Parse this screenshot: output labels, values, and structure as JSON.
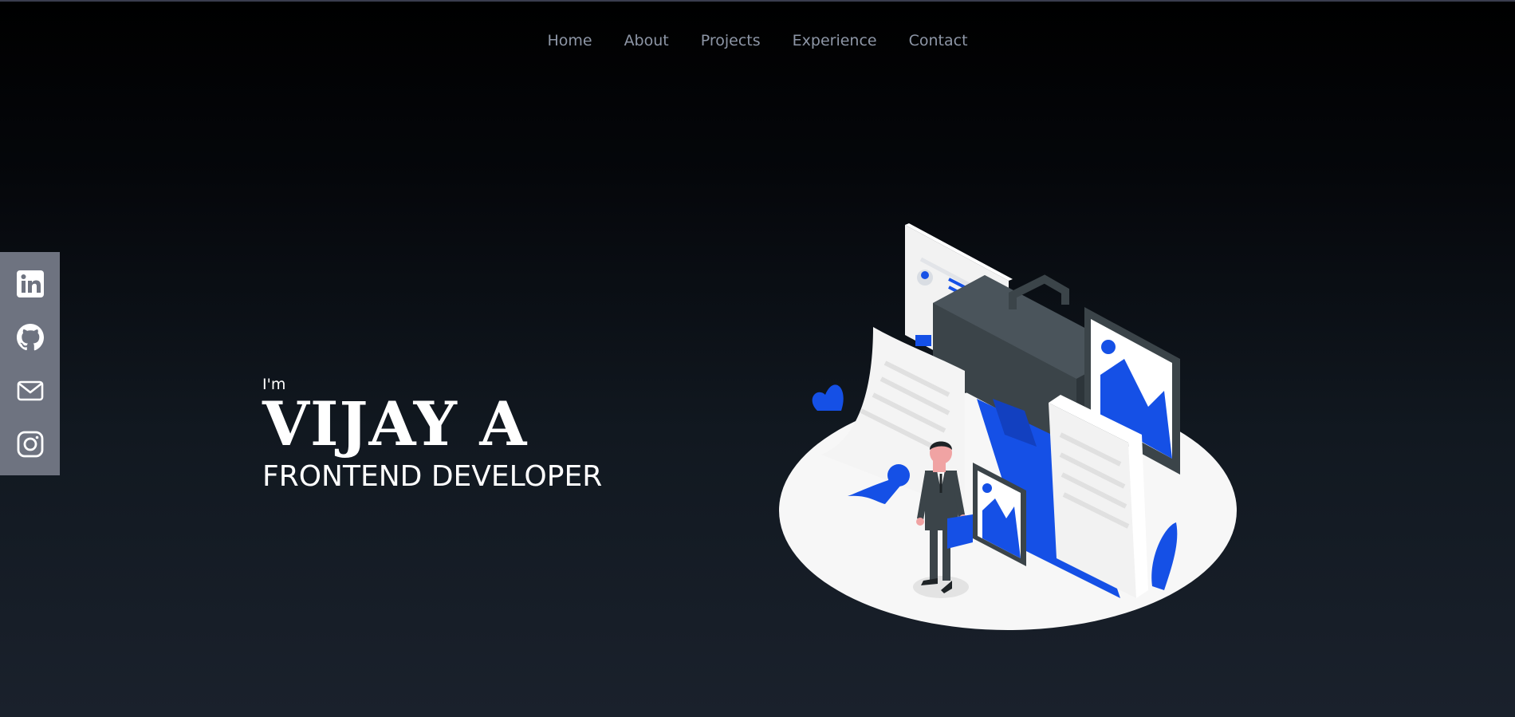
{
  "nav": {
    "items": [
      "Home",
      "About",
      "Projects",
      "Experience",
      "Contact"
    ]
  },
  "social": {
    "icons": [
      "linkedin-icon",
      "github-icon",
      "mail-icon",
      "instagram-icon"
    ]
  },
  "hero": {
    "intro": "I'm",
    "name": "VIJAY A",
    "role": "FRONTEND DEVELOPER"
  },
  "illustration": {
    "name": "portfolio-illustration"
  },
  "colors": {
    "accent": "#1550e6",
    "nav_text": "#8d96a6",
    "sidebar_bg": "#6e7380",
    "dark_gray": "#3b4449",
    "ellipse": "#f7f7f7"
  }
}
